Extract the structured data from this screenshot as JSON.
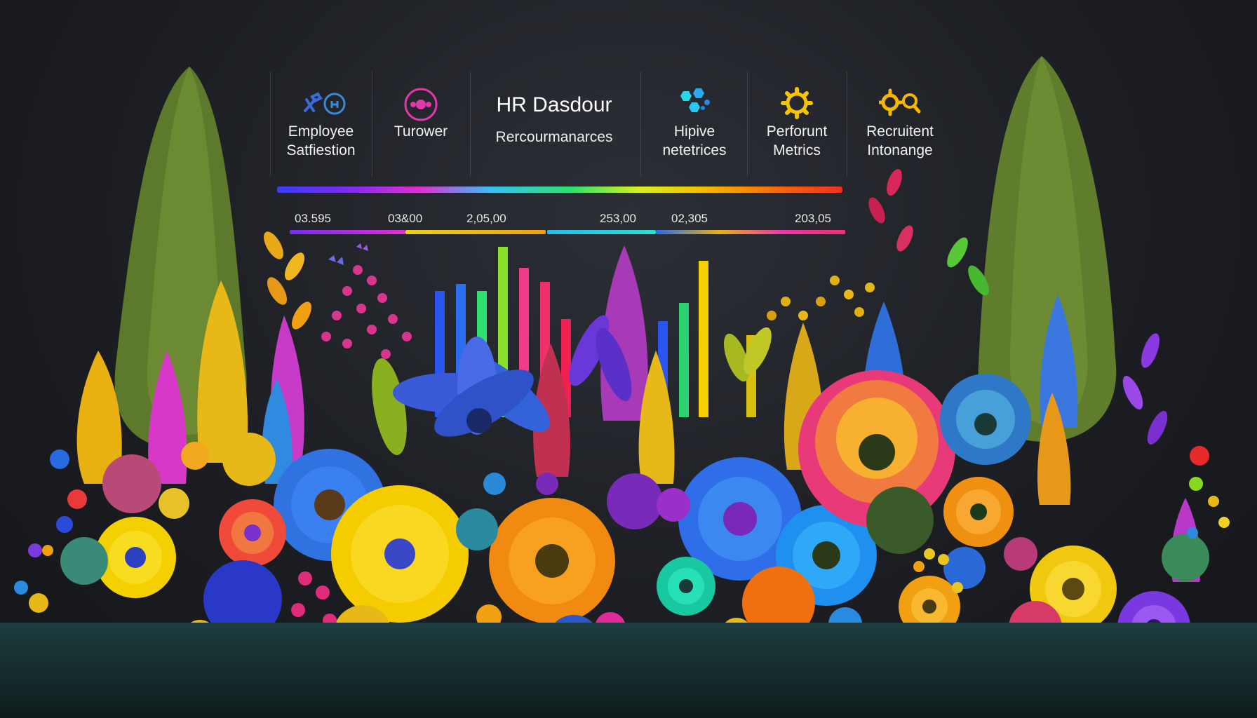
{
  "dashboard": {
    "title": "HR Dasdour",
    "subtitle": "Rercourmanarces",
    "metrics": [
      {
        "line1": "Employee",
        "line2": "Satfiestion",
        "icon": "people-tools-icon"
      },
      {
        "line1": "Turower",
        "line2": "",
        "icon": "turnover-circle-icon"
      },
      {
        "line1": "Hipive",
        "line2": "netetrices",
        "icon": "hexagon-cluster-icon"
      },
      {
        "line1": "Perforunt",
        "line2": "Metrics",
        "icon": "gear-icon"
      },
      {
        "line1": "Recruitent",
        "line2": "Intonange",
        "icon": "gear-search-icon"
      }
    ],
    "numbers": [
      "03.595",
      "03&00",
      "2,05,00",
      "253,00",
      "02,305",
      "203,05"
    ]
  },
  "colors": {
    "background": "#1c1e23",
    "text": "#f2f2f2",
    "accent_blue": "#2b6fe8",
    "accent_pink": "#e0389a",
    "accent_yellow": "#f5c400",
    "accent_cyan": "#28d8e8"
  }
}
